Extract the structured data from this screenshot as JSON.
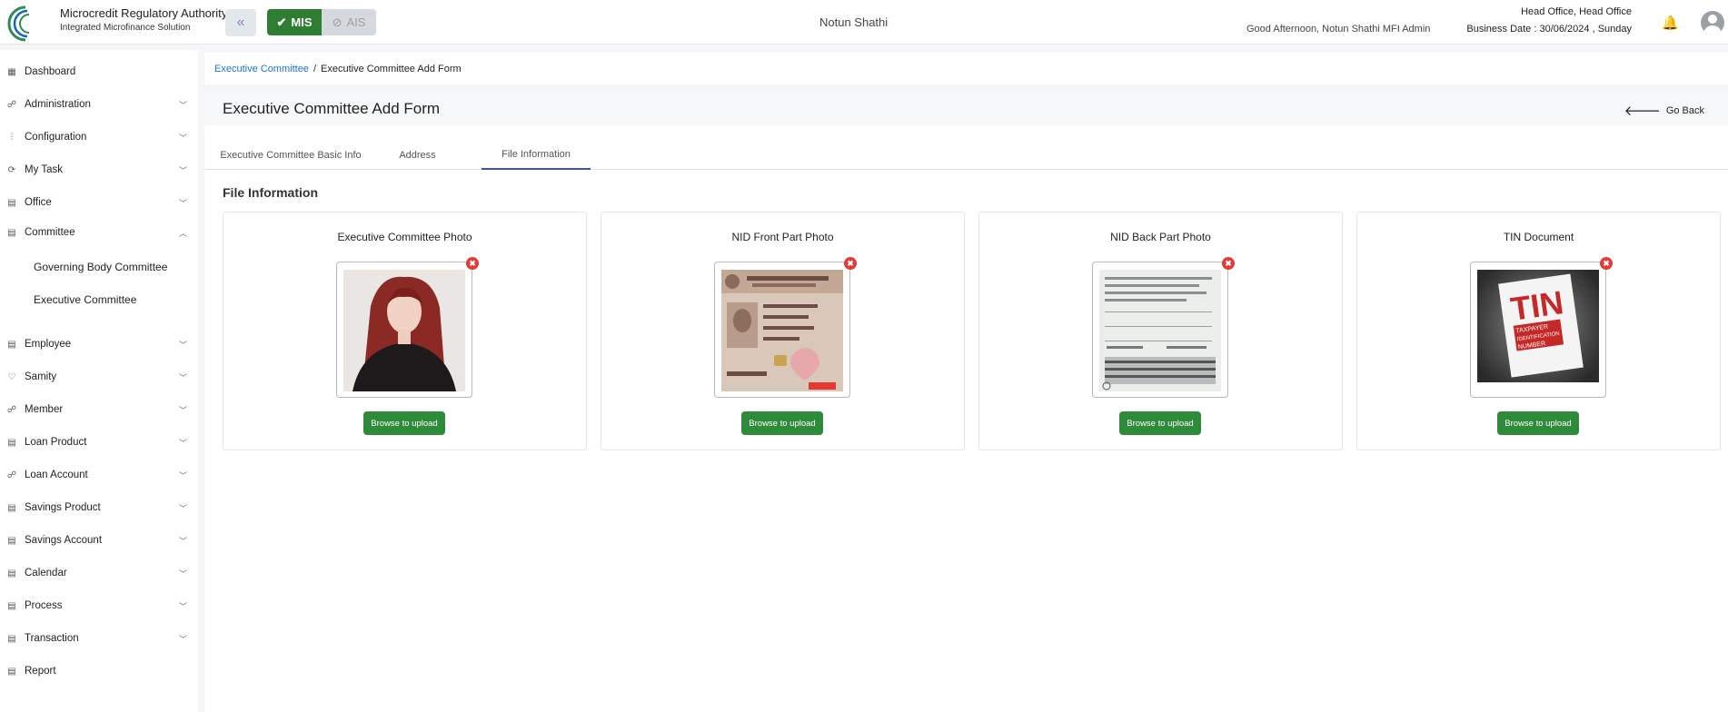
{
  "header": {
    "brand_title": "Microcredit Regulatory Authority",
    "brand_subtitle": "Integrated Microfinance Solution",
    "logo_text": "Microcredit Regulatory Authority",
    "mis_label": "MIS",
    "ais_label": "AIS",
    "center_title": "Notun Shathi",
    "greeting": "Good Afternoon, Notun Shathi MFI Admin",
    "office": "Head Office, Head Office",
    "business_date": "Business Date : 30/06/2024 , Sunday"
  },
  "sidebar": {
    "items": [
      {
        "label": "Dashboard",
        "icon": "grid-icon"
      },
      {
        "label": "Administration",
        "icon": "users-icon"
      },
      {
        "label": "Configuration",
        "icon": "sliders-icon"
      },
      {
        "label": "My Task",
        "icon": "refresh-icon"
      },
      {
        "label": "Office",
        "icon": "building-icon"
      },
      {
        "label": "Committee",
        "icon": "committee-icon"
      },
      {
        "label": "Employee",
        "icon": "employee-icon"
      },
      {
        "label": "Samity",
        "icon": "handshake-icon"
      },
      {
        "label": "Member",
        "icon": "member-icon"
      },
      {
        "label": "Loan Product",
        "icon": "product-icon"
      },
      {
        "label": "Loan Account",
        "icon": "account-icon"
      },
      {
        "label": "Savings Product",
        "icon": "product-icon"
      },
      {
        "label": "Savings Account",
        "icon": "account-icon"
      },
      {
        "label": "Calendar",
        "icon": "calendar-icon"
      },
      {
        "label": "Process",
        "icon": "process-icon"
      },
      {
        "label": "Transaction",
        "icon": "transaction-icon"
      },
      {
        "label": "Report",
        "icon": "report-icon"
      }
    ],
    "committee_sub": [
      "Governing Body Committee",
      "Executive Committee"
    ]
  },
  "breadcrumb": {
    "parent": "Executive Committee",
    "separator": "/",
    "current": "Executive Committee Add Form"
  },
  "page": {
    "title": "Executive Committee Add Form",
    "go_back": "Go Back",
    "tabs": [
      "Executive Committee Basic Info",
      "Address",
      "File Information"
    ],
    "active_tab": "File Information",
    "section_title": "File Information"
  },
  "files": [
    {
      "title": "Executive Committee Photo",
      "button": "Browse to upload"
    },
    {
      "title": "NID Front Part Photo",
      "button": "Browse to upload"
    },
    {
      "title": "NID Back Part Photo",
      "button": "Browse to upload"
    },
    {
      "title": "TIN Document",
      "button": "Browse to upload"
    }
  ],
  "tin_doc": {
    "big": "TIN",
    "l1": "TAXPAYER",
    "l2": "IDENTIFICATION",
    "l3": "NUMBER"
  },
  "colors": {
    "accent_blue": "#1a73e8",
    "mis_green": "#2e7d32",
    "upload_green": "#2e8b3a",
    "tab_indicator": "#3f51b5",
    "remove_red": "#e53935"
  }
}
